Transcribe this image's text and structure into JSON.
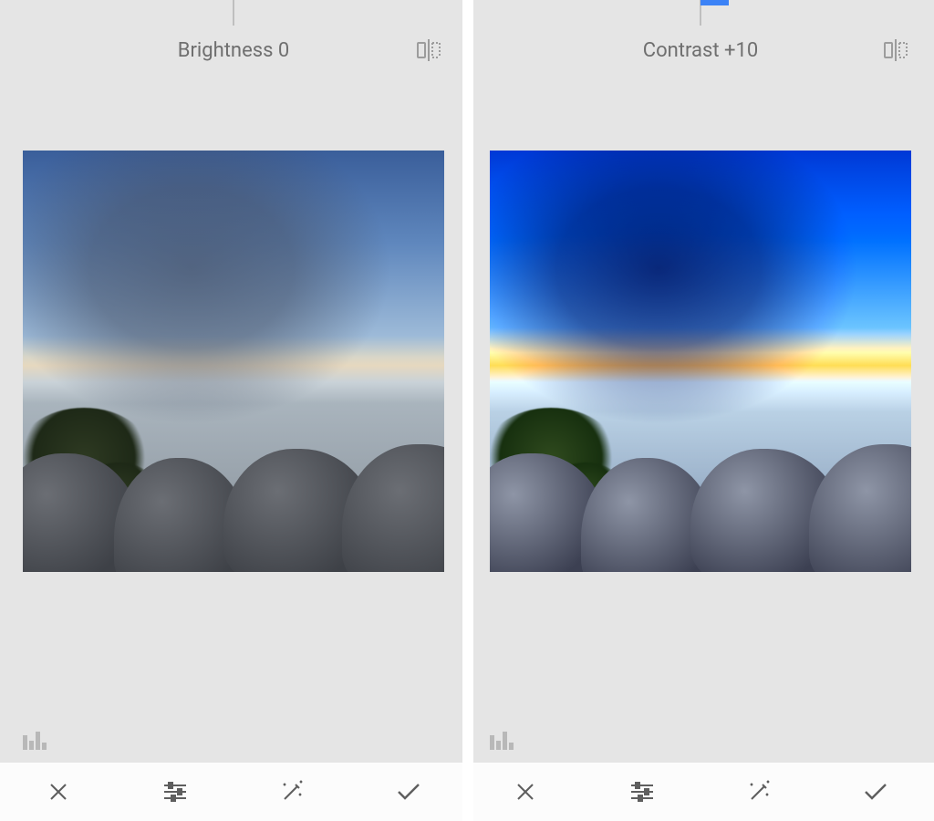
{
  "panes": [
    {
      "adjustment_label": "Brightness 0",
      "slider_offset_percent": 0
    },
    {
      "adjustment_label": "Contrast +10",
      "slider_offset_percent": 10
    }
  ],
  "colors": {
    "accent": "#3b82f6",
    "icon": "#5e5e5e",
    "muted_icon": "#b8b8b8"
  },
  "icons": {
    "compare": "compare-icon",
    "histogram": "histogram-icon",
    "close": "close-icon",
    "tune": "tune-icon",
    "auto_fix": "auto-fix-icon",
    "check": "check-icon"
  }
}
